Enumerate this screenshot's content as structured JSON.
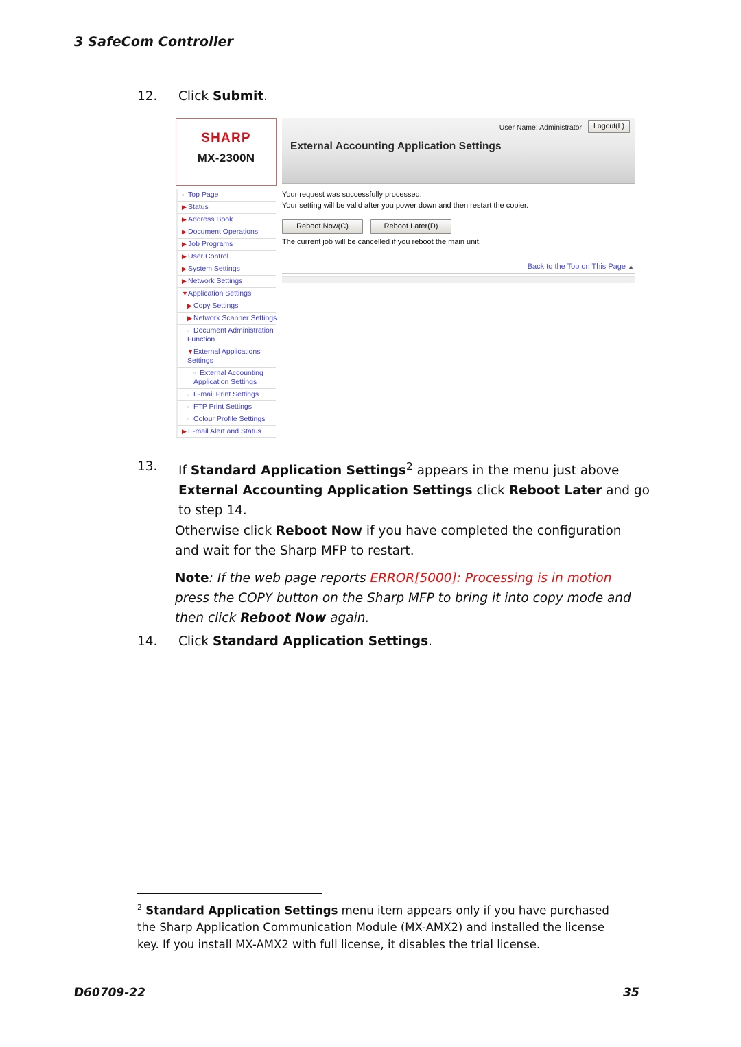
{
  "page": {
    "running_header": "3 SafeCom Controller",
    "footer_doc_number": "D60709-22",
    "footer_page_number": "35"
  },
  "steps": {
    "step12": {
      "number": "12.",
      "text_plain": "Click ",
      "text_bold": "Submit",
      "text_tail": "."
    },
    "step13": {
      "number": "13.",
      "line1_a": "If ",
      "line1_bold": "Standard Application Settings",
      "line1_sup": "2",
      "line1_b": " appears in the menu just above ",
      "line2_bold": "External Accounting Application Settings",
      "line2_a": " click ",
      "line2_bold2": "Reboot Later",
      "line2_b": " and go to step 14."
    },
    "step13_otherwise": {
      "a": "Otherwise click ",
      "bold": "Reboot Now",
      "b": " if you have completed the configuration and wait for the Sharp MFP to restart."
    },
    "note": {
      "label": "Note",
      "a": ": If the web page reports ",
      "error": "ERROR[5000]: Processing is in motion",
      "b": " press the COPY button on the Sharp MFP to bring it into copy mode and then click ",
      "bold": "Reboot Now",
      "c": " again."
    },
    "step14": {
      "number": "14.",
      "text_plain": "Click ",
      "text_bold": "Standard Application Settings",
      "text_tail": "."
    }
  },
  "footnote": {
    "marker": "2",
    "bold": "Standard Application Settings",
    "body": " menu item appears only if you have purchased the Sharp Application Communication Module (MX-AMX2) and installed the license key. If you install MX-AMX2 with full license, it disables the trial license."
  },
  "screenshot": {
    "brand": "SHARP",
    "model": "MX-2300N",
    "page_title": "External Accounting Application Settings",
    "user_label": "User Name: Administrator",
    "logout_button": "Logout(L)",
    "messages": {
      "line1": "Your request was successfully processed.",
      "line2": "Your setting will be valid after you power down and then restart the copier.",
      "line3": "The current job will be cancelled if you reboot the main unit."
    },
    "buttons": {
      "reboot_now": "Reboot Now(C)",
      "reboot_later": "Reboot Later(D)"
    },
    "back_to_top": "Back to the Top on This Page",
    "back_to_top_icon": "▲",
    "colors": {
      "brand_red": "#d4121a",
      "link_blue": "#3a3ad0",
      "marker_red": "#d41414",
      "error_red": "#e8110f"
    },
    "nav": [
      {
        "label": "Top Page",
        "level": 1,
        "marker": "square"
      },
      {
        "label": "Status",
        "level": 1,
        "marker": "right"
      },
      {
        "label": "Address Book",
        "level": 1,
        "marker": "right"
      },
      {
        "label": "Document Operations",
        "level": 1,
        "marker": "right"
      },
      {
        "label": "Job Programs",
        "level": 1,
        "marker": "right"
      },
      {
        "label": "User Control",
        "level": 1,
        "marker": "right"
      },
      {
        "label": "System Settings",
        "level": 1,
        "marker": "right"
      },
      {
        "label": "Network Settings",
        "level": 1,
        "marker": "right"
      },
      {
        "label": "Application Settings",
        "level": 1,
        "marker": "down"
      },
      {
        "label": "Copy Settings",
        "level": 2,
        "marker": "right"
      },
      {
        "label": "Network Scanner Settings",
        "level": 2,
        "marker": "right"
      },
      {
        "label": "Document Administration Function",
        "level": 2,
        "marker": "square"
      },
      {
        "label": "External Applications Settings",
        "level": 2,
        "marker": "down"
      },
      {
        "label": "External Accounting Application Settings",
        "level": 3,
        "marker": "square"
      },
      {
        "label": "E-mail Print Settings",
        "level": 2,
        "marker": "square"
      },
      {
        "label": "FTP Print Settings",
        "level": 2,
        "marker": "square"
      },
      {
        "label": "Colour Profile Settings",
        "level": 2,
        "marker": "square"
      },
      {
        "label": "E-mail Alert and Status",
        "level": 1,
        "marker": "right"
      }
    ]
  }
}
